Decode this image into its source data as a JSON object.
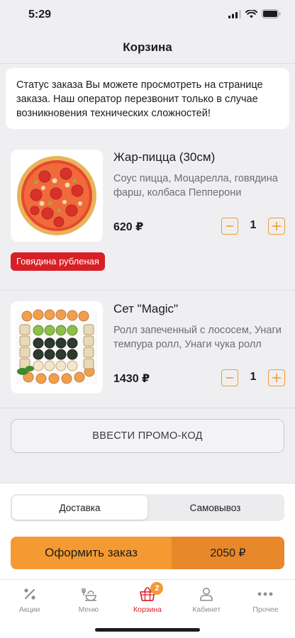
{
  "status_bar": {
    "time": "5:29"
  },
  "header": {
    "title": "Корзина"
  },
  "info": {
    "text": "Статус заказа Вы можете просмотреть на странице заказа. Наш оператор перезвонит только в случае возникновения технических сложностей!"
  },
  "cart": {
    "items": [
      {
        "name": "Жар-пицца (30см)",
        "description": "Соус пицца, Моцарелла, говядина фарш, колбаса Пепперони",
        "price": "620 ₽",
        "quantity": "1",
        "option": "Говядина рубленая",
        "image_icon": "pizza-image"
      },
      {
        "name": "Сет \"Magic\"",
        "description": "Ролл запеченный с лососем, Унаги темпура ролл, Унаги чука ролл",
        "price": "1430 ₽",
        "quantity": "1",
        "image_icon": "sushi-set-image"
      }
    ]
  },
  "promo": {
    "label": "ВВЕСТИ ПРОМО-КОД"
  },
  "delivery": {
    "options": [
      "Доставка",
      "Самовывоз"
    ],
    "selected": "Доставка"
  },
  "checkout": {
    "label": "Оформить заказ",
    "total": "2050 ₽"
  },
  "tabs": [
    {
      "label": "Акции",
      "icon": "percent-icon"
    },
    {
      "label": "Меню",
      "icon": "menu-dish-icon"
    },
    {
      "label": "Корзина",
      "icon": "basket-icon",
      "badge": "2",
      "active": true
    },
    {
      "label": "Кабинет",
      "icon": "user-icon"
    },
    {
      "label": "Прочее",
      "icon": "more-icon"
    }
  ],
  "colors": {
    "accent": "#f59a32",
    "accent_dark": "#e8882a",
    "active_red": "#d81f26",
    "background": "#efeff1"
  }
}
